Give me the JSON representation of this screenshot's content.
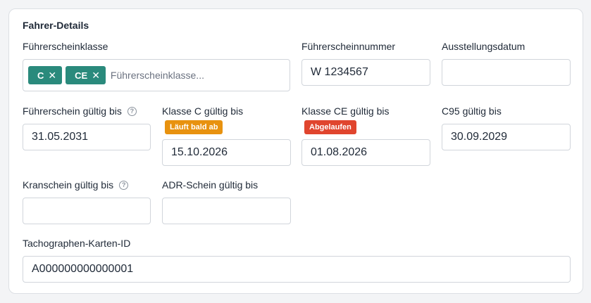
{
  "section": {
    "title": "Fahrer-Details"
  },
  "license_class": {
    "label": "Führerscheinklasse",
    "tags": [
      {
        "label": "C",
        "remove": "✕"
      },
      {
        "label": "CE",
        "remove": "✕"
      }
    ],
    "placeholder": "Führerscheinklasse..."
  },
  "license_number": {
    "label": "Führerscheinnummer",
    "value": "W 1234567"
  },
  "issue_date": {
    "label": "Ausstellungsdatum",
    "value": ""
  },
  "license_valid_until": {
    "label": "Führerschein gültig bis",
    "help": "?",
    "value": "31.05.2031"
  },
  "class_c_valid_until": {
    "label": "Klasse C gültig bis",
    "badge": "Läuft bald ab",
    "badge_color": "#e8920f",
    "value": "15.10.2026"
  },
  "class_ce_valid_until": {
    "label": "Klasse CE gültig bis",
    "badge": "Abgelaufen",
    "badge_color": "#e0452e",
    "value": "01.08.2026"
  },
  "c95_valid_until": {
    "label": "C95 gültig bis",
    "value": "30.09.2029"
  },
  "crane_license_valid_until": {
    "label": "Kranschein gültig bis",
    "help": "?",
    "value": ""
  },
  "adr_license_valid_until": {
    "label": "ADR-Schein gültig bis",
    "value": ""
  },
  "tachograph_card_id": {
    "label": "Tachographen-Karten-ID",
    "value": "A000000000000001"
  },
  "colors": {
    "tag_bg": "#2a8a7c",
    "text": "#1f2937",
    "border": "#d1d5db"
  }
}
